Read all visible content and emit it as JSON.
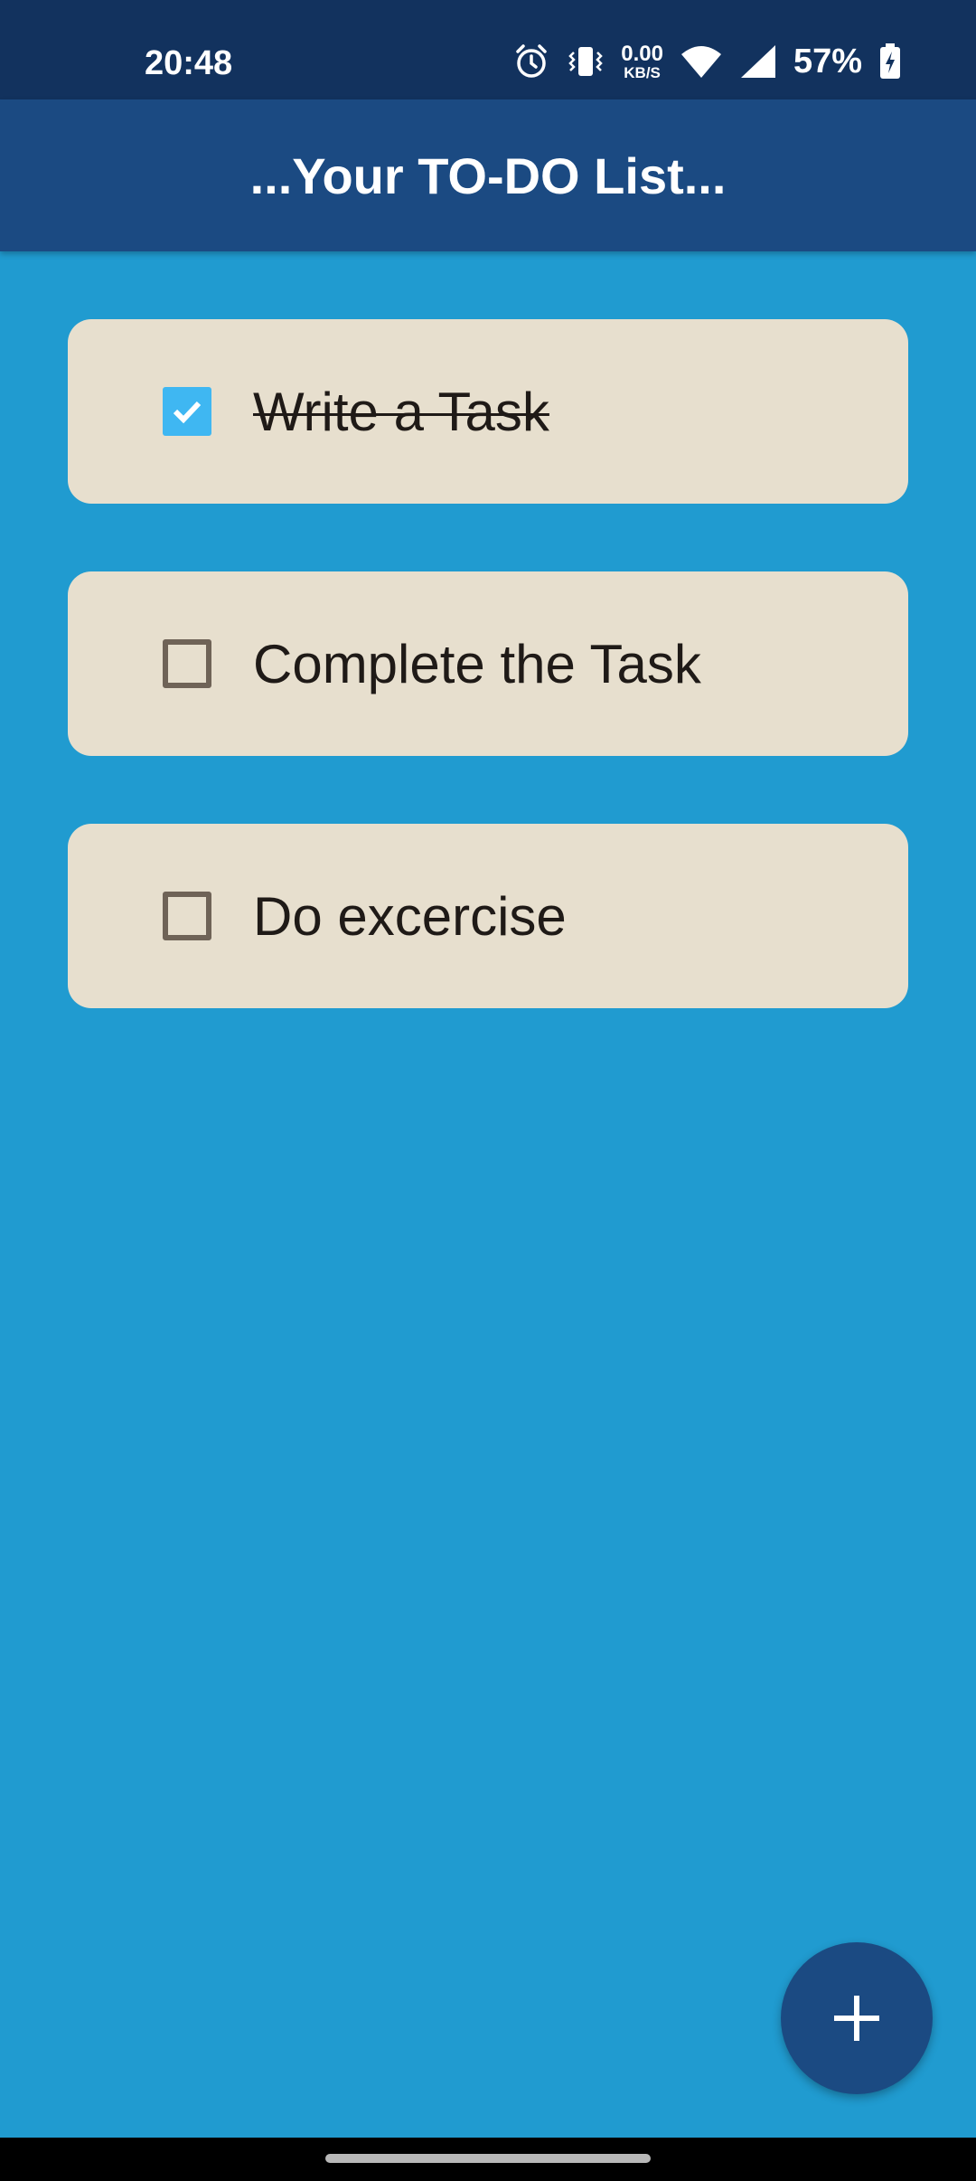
{
  "status_bar": {
    "time": "20:48",
    "net_speed_value": "0.00",
    "net_speed_unit": "KB/S",
    "battery": "57%",
    "icons": [
      "alarm-icon",
      "vibrate-icon",
      "wifi-icon",
      "cell-signal-icon",
      "battery-charging-icon"
    ]
  },
  "app_bar": {
    "title": "...Your TO-DO List..."
  },
  "tasks": [
    {
      "label": "Write a Task",
      "checked": true
    },
    {
      "label": "Complete the Task",
      "checked": false
    },
    {
      "label": "Do excercise",
      "checked": false
    }
  ],
  "fab": {
    "icon": "plus-icon"
  },
  "colors": {
    "status_bar": "#12325e",
    "app_bar": "#1b4a82",
    "background": "#209bd0",
    "card": "#e7dfce",
    "checkbox_checked": "#3fb7f2",
    "fab": "#1b4a82"
  }
}
